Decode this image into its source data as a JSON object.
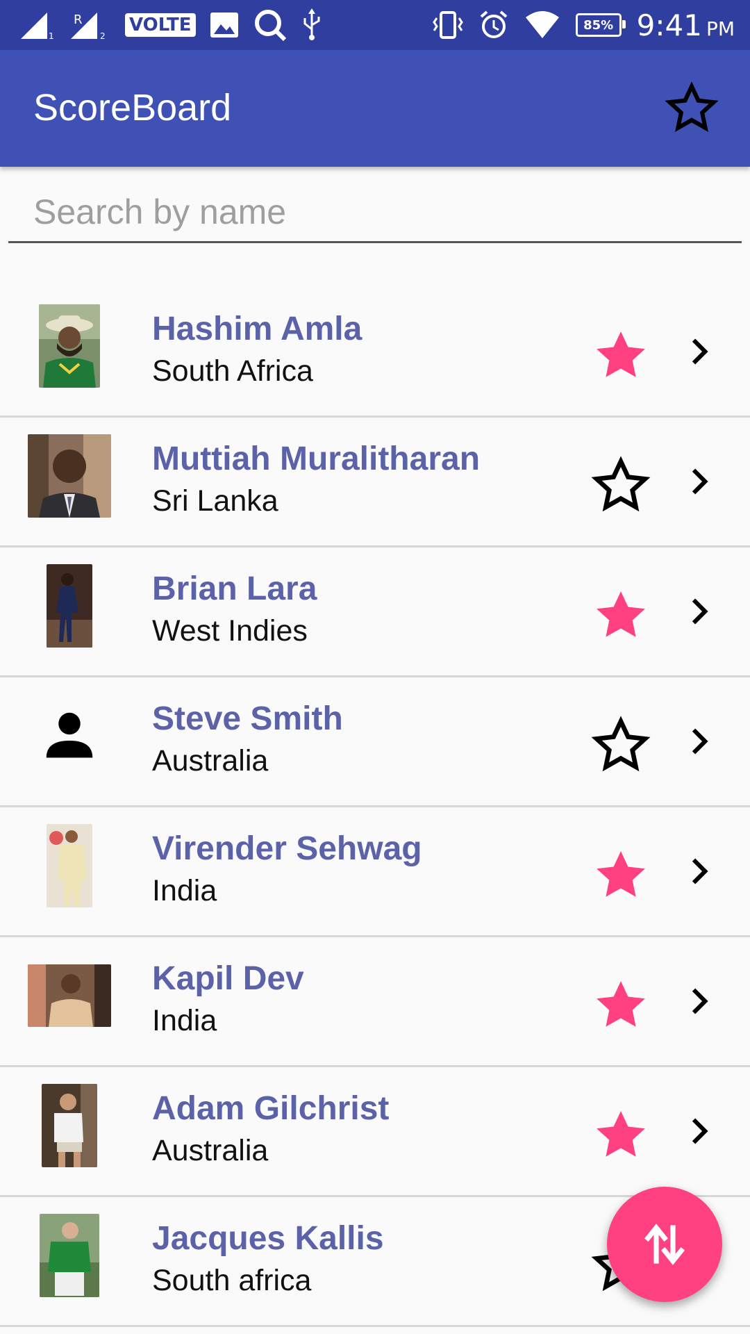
{
  "status_bar": {
    "network_badge": "VOLTE",
    "signal_1_label": "1",
    "signal_2_label": "2",
    "roaming_label": "R",
    "battery": "85%",
    "time": "9:41",
    "ampm": "PM"
  },
  "app_bar": {
    "title": "ScoreBoard",
    "favorites_icon": "star-outline-icon"
  },
  "search": {
    "placeholder": "Search by name",
    "value": ""
  },
  "colors": {
    "status_bar": "#303f9f",
    "app_bar": "#3f51b5",
    "name_text": "#5c62a8",
    "favorite_star": "#ff4081",
    "fab": "#ff4081"
  },
  "players": [
    {
      "name": "Hashim Amla",
      "country": "South Africa",
      "favorite": true
    },
    {
      "name": "Muttiah Muralitharan",
      "country": "Sri Lanka",
      "favorite": false
    },
    {
      "name": "Brian Lara",
      "country": "West Indies",
      "favorite": true
    },
    {
      "name": "Steve Smith",
      "country": "Australia",
      "favorite": false
    },
    {
      "name": "Virender Sehwag",
      "country": "India",
      "favorite": true
    },
    {
      "name": "Kapil Dev",
      "country": "India",
      "favorite": true
    },
    {
      "name": "Adam Gilchrist",
      "country": "Australia",
      "favorite": true
    },
    {
      "name": "Jacques Kallis",
      "country": "South africa",
      "favorite": false
    }
  ],
  "fab": {
    "icon": "swap-vertical-icon"
  }
}
